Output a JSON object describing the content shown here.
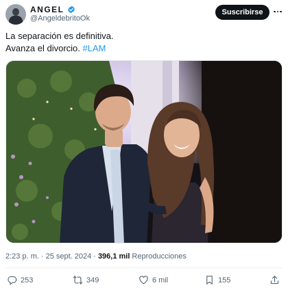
{
  "user": {
    "name": "ANGEL",
    "handle": "@AngeldebritoOk"
  },
  "subscribe_label": "Suscribirse",
  "tweet": {
    "line1": "La separación es definitiva.",
    "line2": "Avanza el divorcio.",
    "hashtag": "#LAM"
  },
  "meta": {
    "time": "2:23 p. m.",
    "separator": "·",
    "date": "25 sept. 2024",
    "views_count": "396,1 mil",
    "views_label": "Reproducciones"
  },
  "actions": {
    "replies": "253",
    "reposts": "349",
    "likes": "6 mil",
    "bookmarks": "155"
  },
  "colors": {
    "accent": "#1d9bf0",
    "text": "#0f1419",
    "muted": "#536471"
  }
}
